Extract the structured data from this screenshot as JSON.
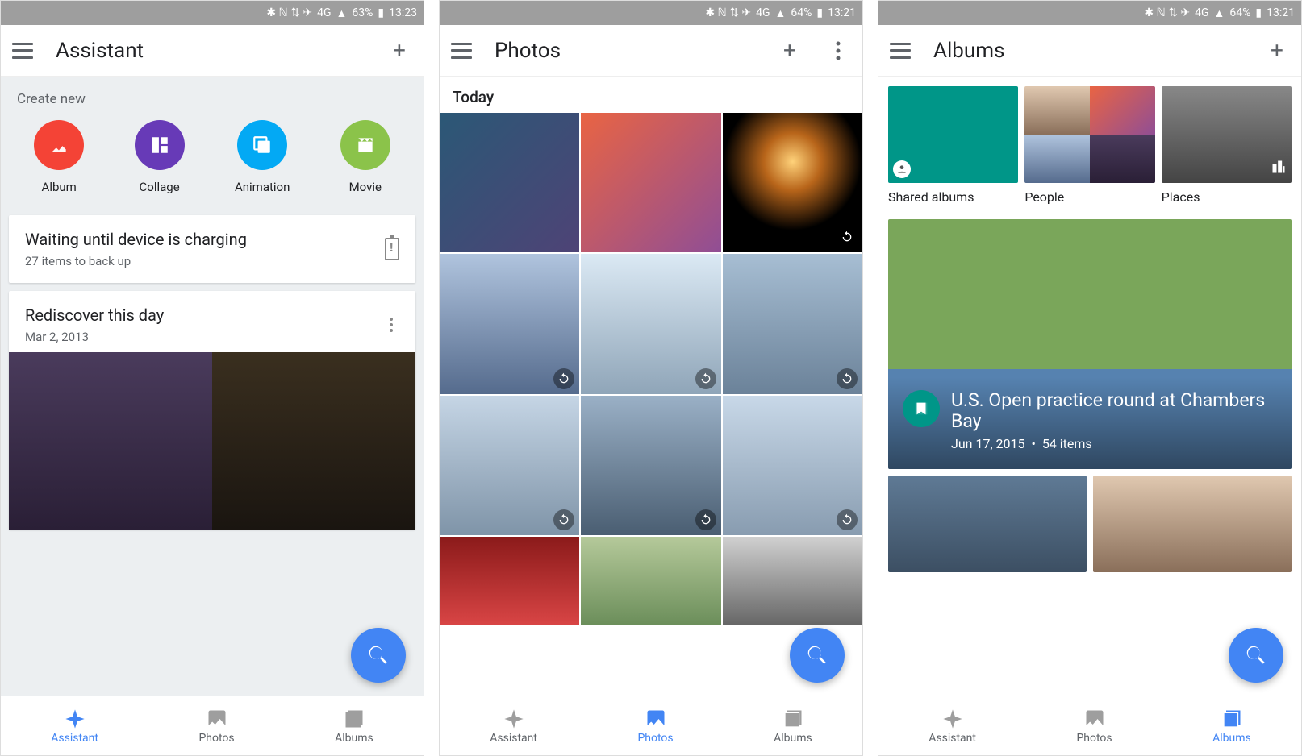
{
  "screens": [
    {
      "status": {
        "battery": "63%",
        "time": "13:23",
        "net": "4G"
      },
      "title": "Assistant",
      "create_label": "Create new",
      "create_items": [
        {
          "label": "Album"
        },
        {
          "label": "Collage"
        },
        {
          "label": "Animation"
        },
        {
          "label": "Movie"
        }
      ],
      "backup_card": {
        "title": "Waiting until device is charging",
        "subtitle": "27 items to back up"
      },
      "memory_card": {
        "title": "Rediscover this day",
        "date": "Mar 2, 2013"
      },
      "nav": {
        "assistant": "Assistant",
        "photos": "Photos",
        "albums": "Albums",
        "active": "assistant"
      }
    },
    {
      "status": {
        "battery": "64%",
        "time": "13:21",
        "net": "4G"
      },
      "title": "Photos",
      "section": "Today",
      "nav": {
        "assistant": "Assistant",
        "photos": "Photos",
        "albums": "Albums",
        "active": "photos"
      }
    },
    {
      "status": {
        "battery": "64%",
        "time": "13:21",
        "net": "4G"
      },
      "title": "Albums",
      "categories": [
        {
          "label": "Shared albums"
        },
        {
          "label": "People"
        },
        {
          "label": "Places"
        }
      ],
      "featured": {
        "title": "U.S. Open practice round at Chambers Bay",
        "date": "Jun 17, 2015",
        "sep": "•",
        "count": "54 items"
      },
      "nav": {
        "assistant": "Assistant",
        "photos": "Photos",
        "albums": "Albums",
        "active": "albums"
      }
    }
  ]
}
